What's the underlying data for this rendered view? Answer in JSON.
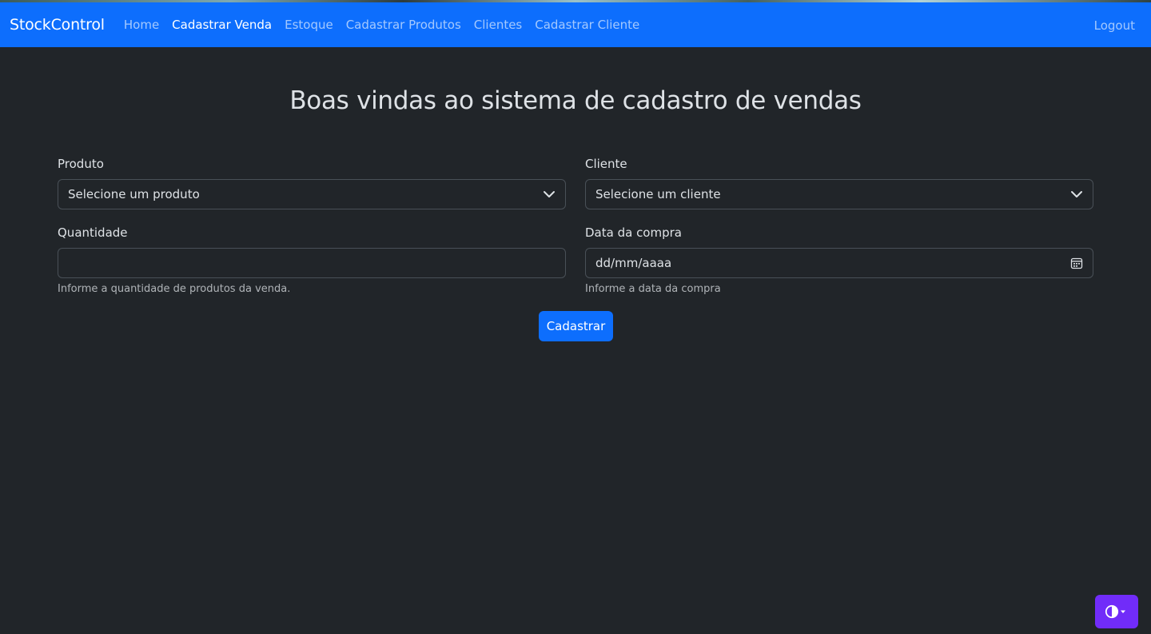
{
  "navbar": {
    "brand": "StockControl",
    "links": [
      {
        "label": "Home",
        "active": false
      },
      {
        "label": "Cadastrar Venda",
        "active": true
      },
      {
        "label": "Estoque",
        "active": false
      },
      {
        "label": "Cadastrar Produtos",
        "active": false
      },
      {
        "label": "Clientes",
        "active": false
      },
      {
        "label": "Cadastrar Cliente",
        "active": false
      }
    ],
    "logout": "Logout"
  },
  "page": {
    "title": "Boas vindas ao sistema de cadastro de vendas"
  },
  "form": {
    "produto": {
      "label": "Produto",
      "selected": "Selecione um produto",
      "icon": "chevron-down-icon"
    },
    "cliente": {
      "label": "Cliente",
      "selected": "Selecione um cliente",
      "icon": "chevron-down-icon"
    },
    "quantidade": {
      "label": "Quantidade",
      "value": "",
      "help": "Informe a quantidade de produtos da venda."
    },
    "data": {
      "label": "Data da compra",
      "placeholder": "dd/mm/aaaa",
      "help": "Informe a data da compra",
      "icon": "calendar-icon"
    },
    "submit_label": "Cadastrar"
  },
  "theme_toggle": {
    "icon": "contrast-icon"
  },
  "colors": {
    "primary": "#0d6efd",
    "background": "#212529",
    "theme_toggle": "#712cf9"
  }
}
